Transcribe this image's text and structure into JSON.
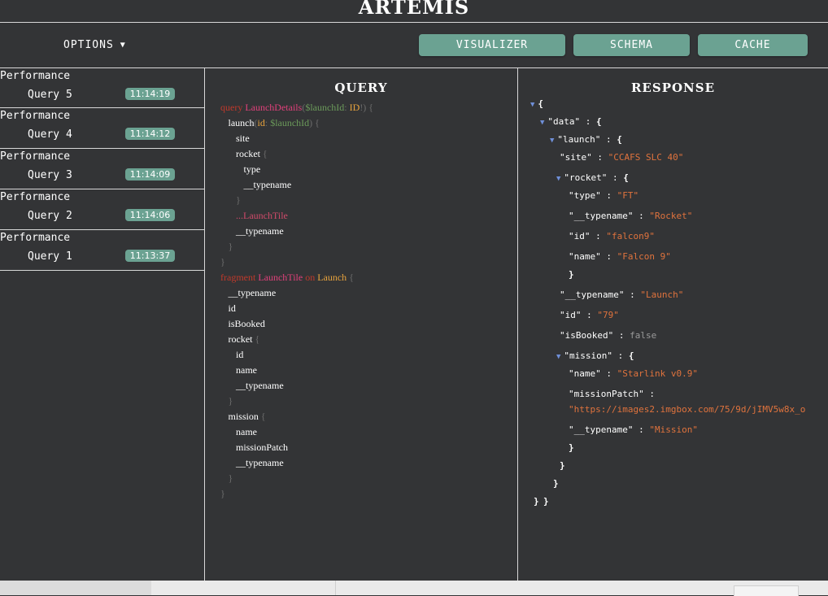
{
  "app": {
    "title": "ARTEMIS"
  },
  "toolbar": {
    "options_label": "OPTIONS",
    "visualizer_label": "VISUALIZER",
    "schema_label": "SCHEMA",
    "cache_label": "CACHE"
  },
  "queries": [
    {
      "category": "Performance",
      "name": "Query 5",
      "time": "11:14:19"
    },
    {
      "category": "Performance",
      "name": "Query 4",
      "time": "11:14:12"
    },
    {
      "category": "Performance",
      "name": "Query 3",
      "time": "11:14:09"
    },
    {
      "category": "Performance",
      "name": "Query 2",
      "time": "11:14:06"
    },
    {
      "category": "Performance",
      "name": "Query 1",
      "time": "11:13:37"
    }
  ],
  "query_panel": {
    "title": "QUERY",
    "lines": [
      {
        "indent": 0,
        "tokens": [
          [
            "kw",
            "query "
          ],
          [
            "fn",
            "LaunchDetails"
          ],
          [
            "punc",
            "("
          ],
          [
            "var",
            "$launchId"
          ],
          [
            "punc",
            ": "
          ],
          [
            "typ",
            "ID"
          ],
          [
            "punc",
            "!) {"
          ]
        ]
      },
      {
        "indent": 1,
        "tokens": [
          [
            "txt",
            "launch"
          ],
          [
            "punc",
            "("
          ],
          [
            "typ",
            "id"
          ],
          [
            "punc",
            ": "
          ],
          [
            "var",
            "$launchId"
          ],
          [
            "punc",
            ") {"
          ]
        ]
      },
      {
        "indent": 2,
        "tokens": [
          [
            "txt",
            "site"
          ]
        ]
      },
      {
        "indent": 2,
        "tokens": [
          [
            "txt",
            "rocket"
          ],
          [
            "punc",
            " {"
          ]
        ]
      },
      {
        "indent": 3,
        "tokens": [
          [
            "txt",
            "type"
          ]
        ]
      },
      {
        "indent": 3,
        "tokens": [
          [
            "txt",
            "__typename"
          ]
        ]
      },
      {
        "indent": 2,
        "tokens": [
          [
            "punc",
            "}"
          ]
        ]
      },
      {
        "indent": 2,
        "tokens": [
          [
            "frag",
            "...LaunchTile"
          ]
        ]
      },
      {
        "indent": 2,
        "tokens": [
          [
            "txt",
            "__typename"
          ]
        ]
      },
      {
        "indent": 1,
        "tokens": [
          [
            "punc",
            "}"
          ]
        ]
      },
      {
        "indent": 0,
        "tokens": [
          [
            "punc",
            "}"
          ]
        ]
      },
      {
        "indent": 0,
        "tokens": [
          [
            "kw",
            "fragment "
          ],
          [
            "fn",
            "LaunchTile"
          ],
          [
            "kw",
            " on "
          ],
          [
            "typ",
            "Launch"
          ],
          [
            "punc",
            " {"
          ]
        ]
      },
      {
        "indent": 1,
        "tokens": [
          [
            "txt",
            "__typename"
          ]
        ]
      },
      {
        "indent": 1,
        "tokens": [
          [
            "txt",
            "id"
          ]
        ]
      },
      {
        "indent": 1,
        "tokens": [
          [
            "txt",
            "isBooked"
          ]
        ]
      },
      {
        "indent": 1,
        "tokens": [
          [
            "txt",
            "rocket"
          ],
          [
            "punc",
            " {"
          ]
        ]
      },
      {
        "indent": 2,
        "tokens": [
          [
            "txt",
            "id"
          ]
        ]
      },
      {
        "indent": 2,
        "tokens": [
          [
            "txt",
            "name"
          ]
        ]
      },
      {
        "indent": 2,
        "tokens": [
          [
            "txt",
            "__typename"
          ]
        ]
      },
      {
        "indent": 1,
        "tokens": [
          [
            "punc",
            "}"
          ]
        ]
      },
      {
        "indent": 1,
        "tokens": [
          [
            "txt",
            "mission"
          ],
          [
            "punc",
            " {"
          ]
        ]
      },
      {
        "indent": 2,
        "tokens": [
          [
            "txt",
            "name"
          ]
        ]
      },
      {
        "indent": 2,
        "tokens": [
          [
            "txt",
            "missionPatch"
          ]
        ]
      },
      {
        "indent": 2,
        "tokens": [
          [
            "txt",
            "__typename"
          ]
        ]
      },
      {
        "indent": 1,
        "tokens": [
          [
            "punc",
            "}"
          ]
        ]
      },
      {
        "indent": 0,
        "tokens": [
          [
            "punc",
            "}"
          ]
        ]
      }
    ]
  },
  "response_panel": {
    "title": "RESPONSE",
    "lines": [
      {
        "depth": 0,
        "toggle": true,
        "key": "",
        "value": "{",
        "type": "open"
      },
      {
        "depth": 1,
        "toggle": true,
        "key": "\"data\"",
        "value": "{",
        "type": "open"
      },
      {
        "depth": 2,
        "toggle": true,
        "key": "\"launch\"",
        "value": "{",
        "type": "open"
      },
      {
        "depth": 3,
        "toggle": false,
        "key": "\"site\"",
        "value": "\"CCAFS SLC 40\"",
        "type": "string"
      },
      {
        "depth": 3,
        "toggle": true,
        "key": "\"rocket\"",
        "value": "{",
        "type": "open"
      },
      {
        "depth": 4,
        "toggle": false,
        "key": "\"type\"",
        "value": "\"FT\"",
        "type": "string"
      },
      {
        "depth": 4,
        "toggle": false,
        "key": "\"__typename\"",
        "value": "\"Rocket\"",
        "type": "string"
      },
      {
        "depth": 4,
        "toggle": false,
        "key": "\"id\"",
        "value": "\"falcon9\"",
        "type": "string"
      },
      {
        "depth": 4,
        "toggle": false,
        "key": "\"name\"",
        "value": "\"Falcon 9\"",
        "type": "string"
      },
      {
        "depth": 4,
        "toggle": false,
        "key": "",
        "value": "}",
        "type": "close"
      },
      {
        "depth": 3,
        "toggle": false,
        "key": "\"__typename\"",
        "value": "\"Launch\"",
        "type": "string"
      },
      {
        "depth": 3,
        "toggle": false,
        "key": "\"id\"",
        "value": "\"79\"",
        "type": "string"
      },
      {
        "depth": 3,
        "toggle": false,
        "key": "\"isBooked\"",
        "value": "false",
        "type": "bool"
      },
      {
        "depth": 3,
        "toggle": true,
        "key": "\"mission\"",
        "value": "{",
        "type": "open"
      },
      {
        "depth": 4,
        "toggle": false,
        "key": "\"name\"",
        "value": "\"Starlink v0.9\"",
        "type": "string"
      },
      {
        "depth": 4,
        "toggle": false,
        "key": "\"missionPatch\"",
        "value": "",
        "type": "keyonly"
      },
      {
        "depth": 4,
        "toggle": false,
        "key": "",
        "value": "\"https://images2.imgbox.com/75/9d/jIMV5w8x_o",
        "type": "string"
      },
      {
        "depth": 4,
        "toggle": false,
        "key": "\"__typename\"",
        "value": "\"Mission\"",
        "type": "string"
      },
      {
        "depth": 4,
        "toggle": false,
        "key": "",
        "value": "}",
        "type": "close"
      },
      {
        "depth": 3,
        "toggle": false,
        "key": "",
        "value": "}",
        "type": "close"
      },
      {
        "depth": 2,
        "toggle": false,
        "key": "",
        "value": "}",
        "type": "close"
      },
      {
        "depth": 1,
        "toggle": false,
        "key": "",
        "value": "}",
        "type": "close"
      },
      {
        "depth": 0,
        "toggle": false,
        "key": "",
        "value": "}",
        "type": "close"
      }
    ]
  },
  "colors": {
    "background": "#333436",
    "accent": "#6ba292",
    "divider": "#d8d8d8",
    "toggle_icon": "#6f8fd8",
    "json_string": "#e0733d"
  },
  "icons": {
    "options_caret": "caret-down-icon",
    "tree_toggle": "triangle-down-icon"
  }
}
